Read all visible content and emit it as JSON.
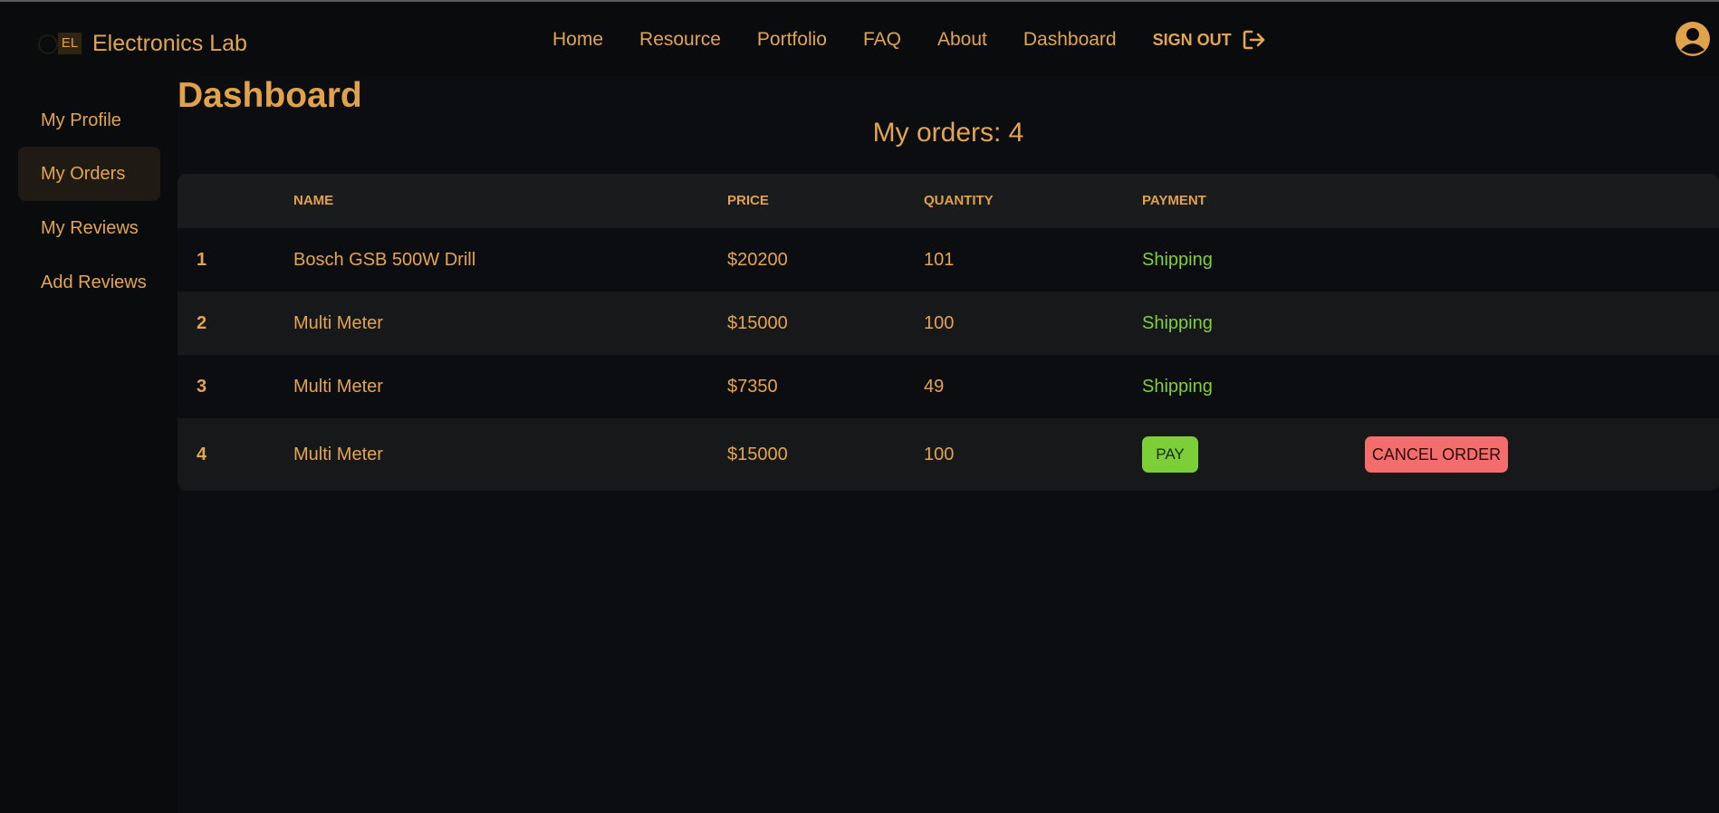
{
  "navbar": {
    "logo_text": "EL",
    "brand": "Electronics Lab",
    "links": [
      "Home",
      "Resource",
      "Portfolio",
      "FAQ",
      "About",
      "Dashboard"
    ],
    "signout_label": "SIGN OUT",
    "signout_icon": "sign-out-icon",
    "avatar_icon": "user-circle-icon"
  },
  "sidebar": {
    "items": [
      "My Profile",
      "My Orders",
      "My Reviews",
      "Add Reviews"
    ],
    "active": "My Orders"
  },
  "main": {
    "title": "Dashboard",
    "orders_heading": "My orders: 4",
    "table": {
      "headers": [
        "NAME",
        "PRICE",
        "QUANTITY",
        "PAYMENT"
      ],
      "rows": [
        {
          "index": "1",
          "name": "Bosch GSB 500W Drill",
          "price": "$20200",
          "quantity": "101",
          "payment": "Shipping"
        },
        {
          "index": "2",
          "name": "Multi Meter",
          "price": "$15000",
          "quantity": "100",
          "payment": "Shipping"
        },
        {
          "index": "3",
          "name": "Multi Meter",
          "price": "$7350",
          "quantity": "49",
          "payment": "Shipping"
        },
        {
          "index": "4",
          "name": "Multi Meter",
          "price": "$15000",
          "quantity": "100",
          "pay_label": "PAY",
          "cancel_label": "CANCEL ORDER"
        }
      ]
    }
  },
  "colors": {
    "accent": "#e3a54e",
    "background": "#0c0d10",
    "shipping": "#7fd03a",
    "pay_button": "#7ccf37",
    "cancel_button": "#f46d6d"
  }
}
